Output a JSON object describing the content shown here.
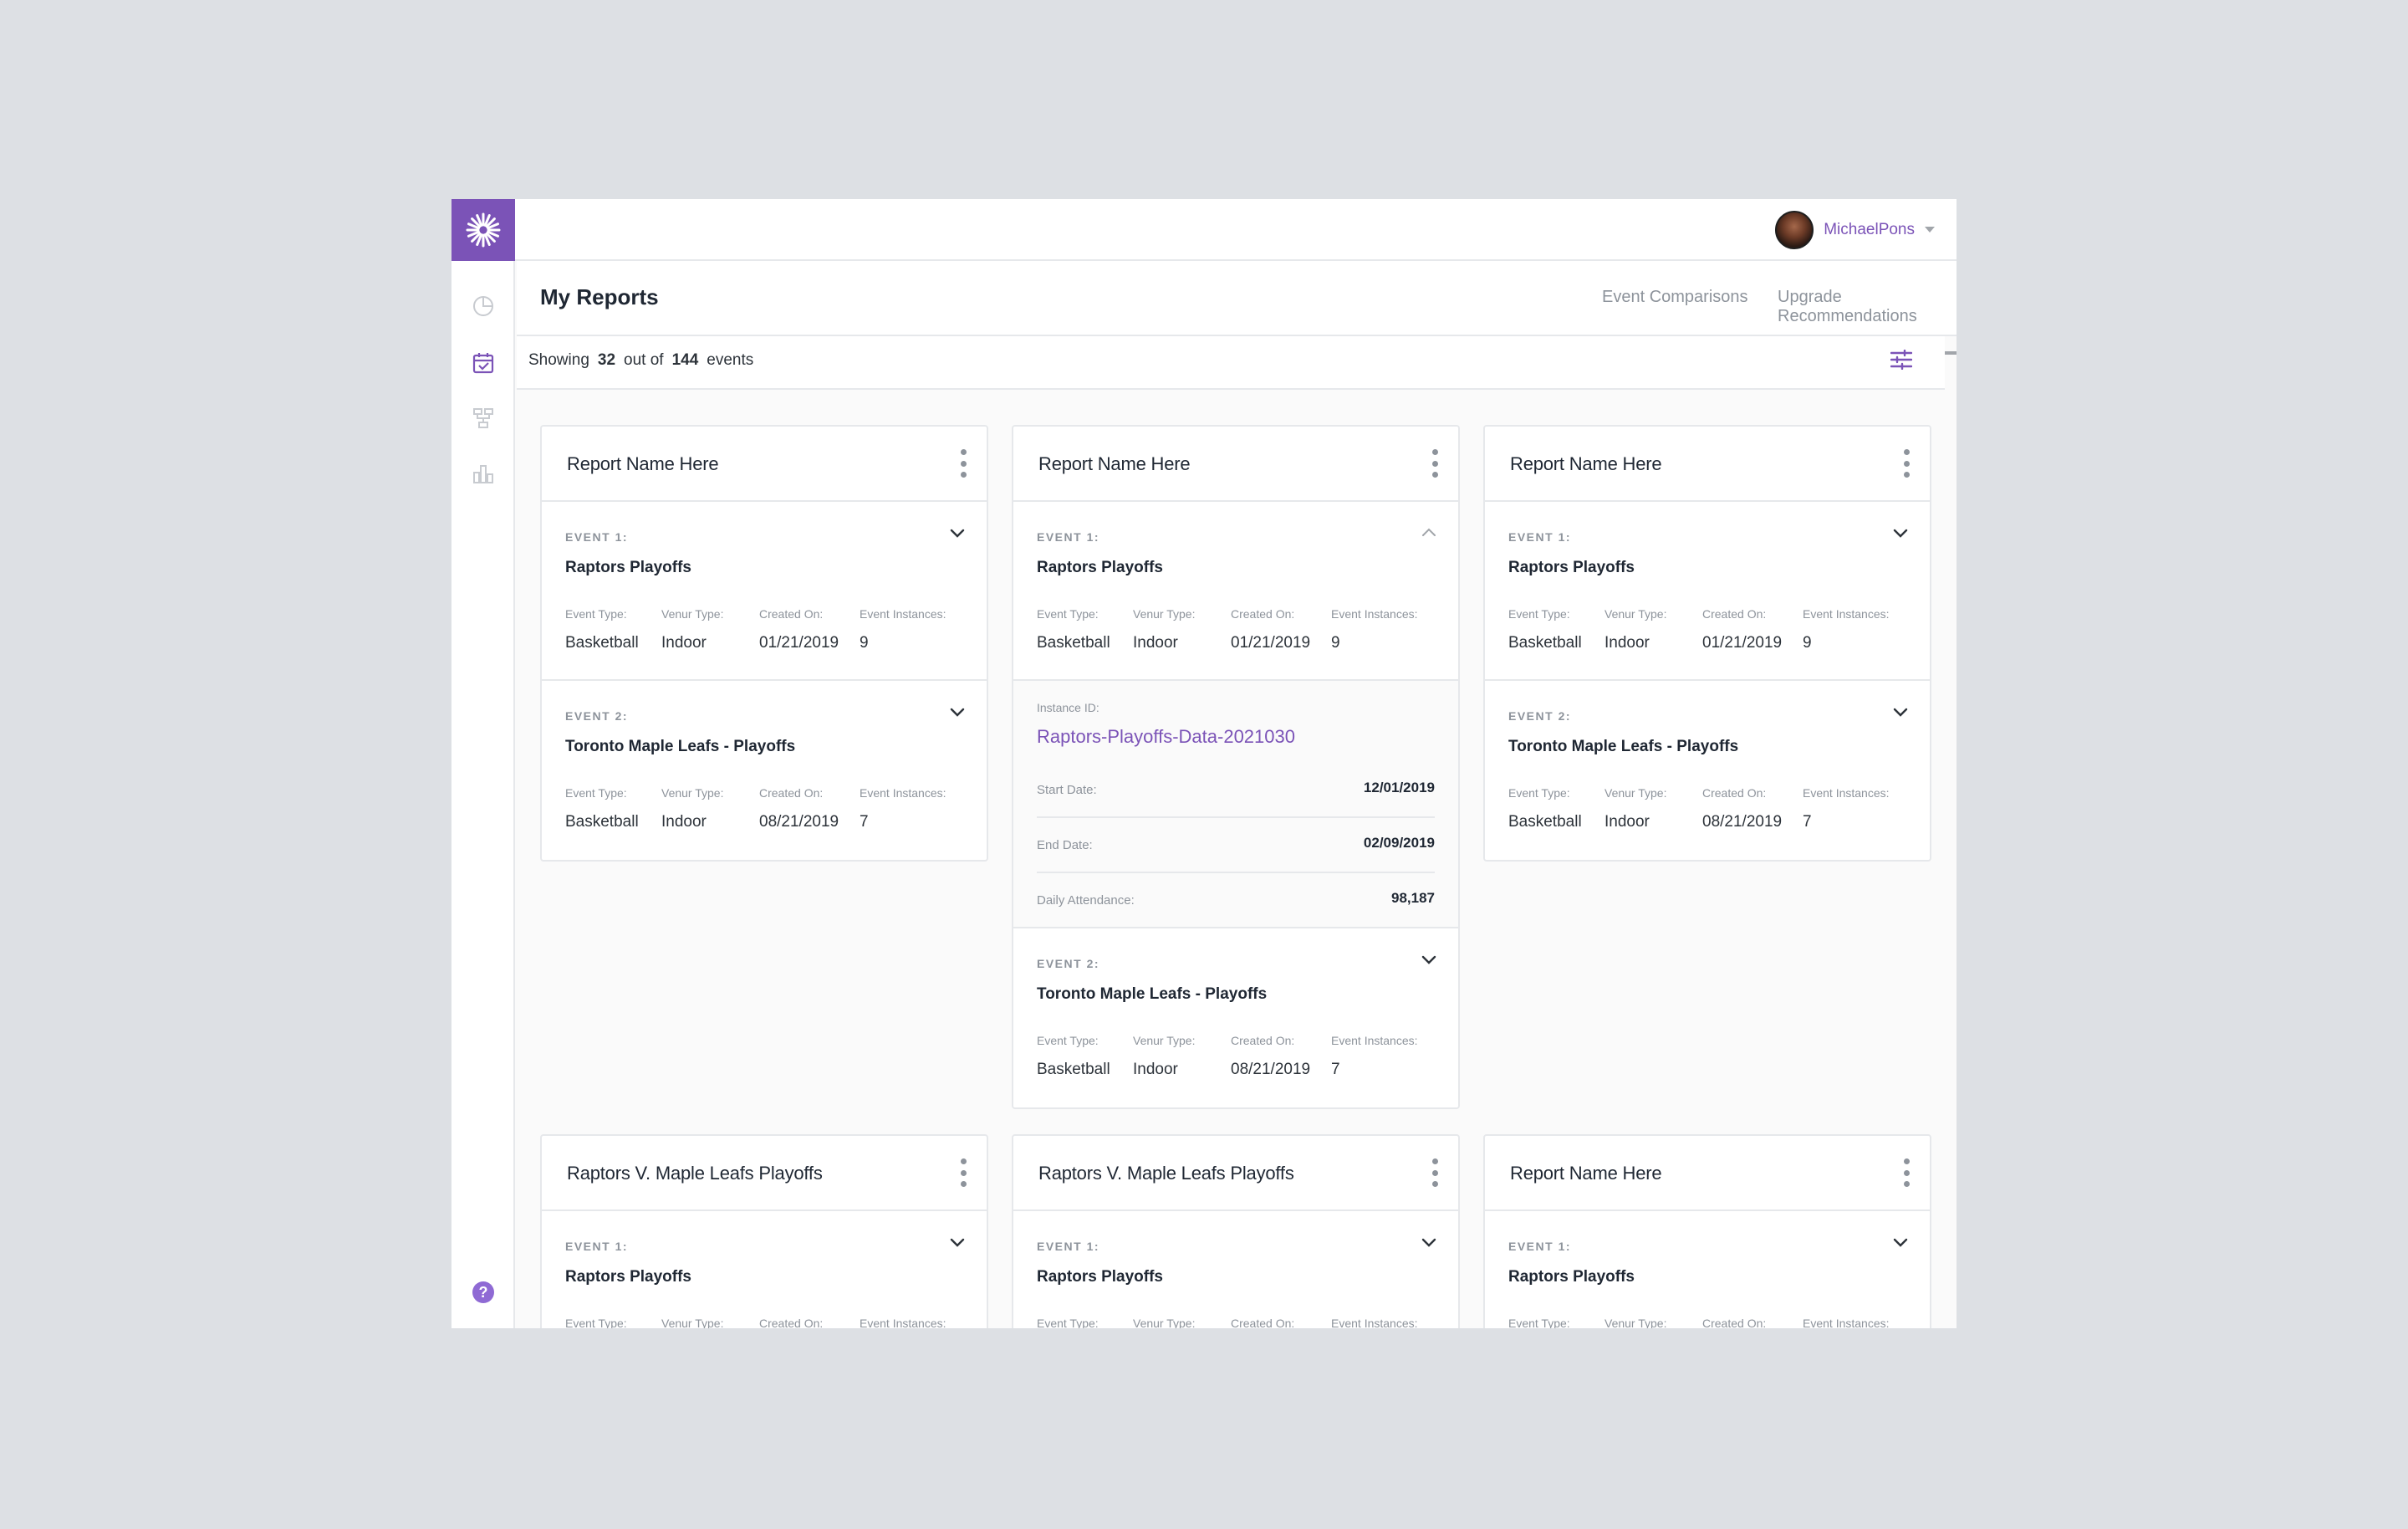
{
  "user": {
    "name": "MichaelPons"
  },
  "header": {
    "title": "My Reports",
    "tabs": [
      {
        "label": "Event Comparisons"
      },
      {
        "label": "Upgrade Recommendations"
      }
    ]
  },
  "summary": {
    "prefix": "Showing",
    "shown": "32",
    "mid": "out of",
    "total": "144",
    "suffix": "events"
  },
  "field_labels": {
    "event_type": "Event Type:",
    "venue_type": "Venur Type:",
    "created_on": "Created On:",
    "instances": "Event Instances:"
  },
  "cards": [
    {
      "title": "Report Name Here",
      "events": [
        {
          "label": "EVENT 1:",
          "name": "Raptors Playoffs",
          "event_type": "Basketball",
          "venue_type": "Indoor",
          "created_on": "01/21/2019",
          "instances": "9"
        },
        {
          "label": "EVENT 2:",
          "name": "Toronto Maple Leafs - Playoffs",
          "event_type": "Basketball",
          "venue_type": "Indoor",
          "created_on": "08/21/2019",
          "instances": "7"
        }
      ]
    },
    {
      "title": "Report Name Here",
      "events": [
        {
          "label": "EVENT 1:",
          "name": "Raptors Playoffs",
          "event_type": "Basketball",
          "venue_type": "Indoor",
          "created_on": "01/21/2019",
          "instances": "9"
        },
        {
          "label": "EVENT 2:",
          "name": "Toronto Maple Leafs - Playoffs",
          "event_type": "Basketball",
          "venue_type": "Indoor",
          "created_on": "08/21/2019",
          "instances": "7"
        }
      ],
      "detail": {
        "instance_label": "Instance ID:",
        "instance_id": "Raptors-Playoffs-Data-2021030",
        "rows": [
          {
            "label": "Start Date:",
            "value": "12/01/2019"
          },
          {
            "label": "End Date:",
            "value": "02/09/2019"
          },
          {
            "label": "Daily Attendance:",
            "value": "98,187"
          }
        ]
      }
    },
    {
      "title": "Report Name Here",
      "events": [
        {
          "label": "EVENT 1:",
          "name": "Raptors Playoffs",
          "event_type": "Basketball",
          "venue_type": "Indoor",
          "created_on": "01/21/2019",
          "instances": "9"
        },
        {
          "label": "EVENT 2:",
          "name": "Toronto Maple Leafs - Playoffs",
          "event_type": "Basketball",
          "venue_type": "Indoor",
          "created_on": "08/21/2019",
          "instances": "7"
        }
      ]
    },
    {
      "title": "Raptors V. Maple Leafs Playoffs",
      "events": [
        {
          "label": "EVENT 1:",
          "name": "Raptors Playoffs"
        }
      ]
    },
    {
      "title": "Raptors V. Maple Leafs Playoffs",
      "events": [
        {
          "label": "EVENT 1:",
          "name": "Raptors Playoffs"
        }
      ]
    },
    {
      "title": "Report Name Here",
      "events": [
        {
          "label": "EVENT 1:",
          "name": "Raptors Playoffs"
        }
      ]
    }
  ],
  "colors": {
    "brand": "#7b53b7",
    "background": "#dde0e4",
    "border": "#e6e8eb",
    "muted": "#8d939b"
  },
  "icons": [
    "logo-icon",
    "pie-chart-icon",
    "calendar-check-icon",
    "hierarchy-icon",
    "bar-chart-icon",
    "help-icon",
    "filter-sliders-icon",
    "kebab-icon",
    "chevron-down-icon",
    "chevron-up-icon"
  ]
}
